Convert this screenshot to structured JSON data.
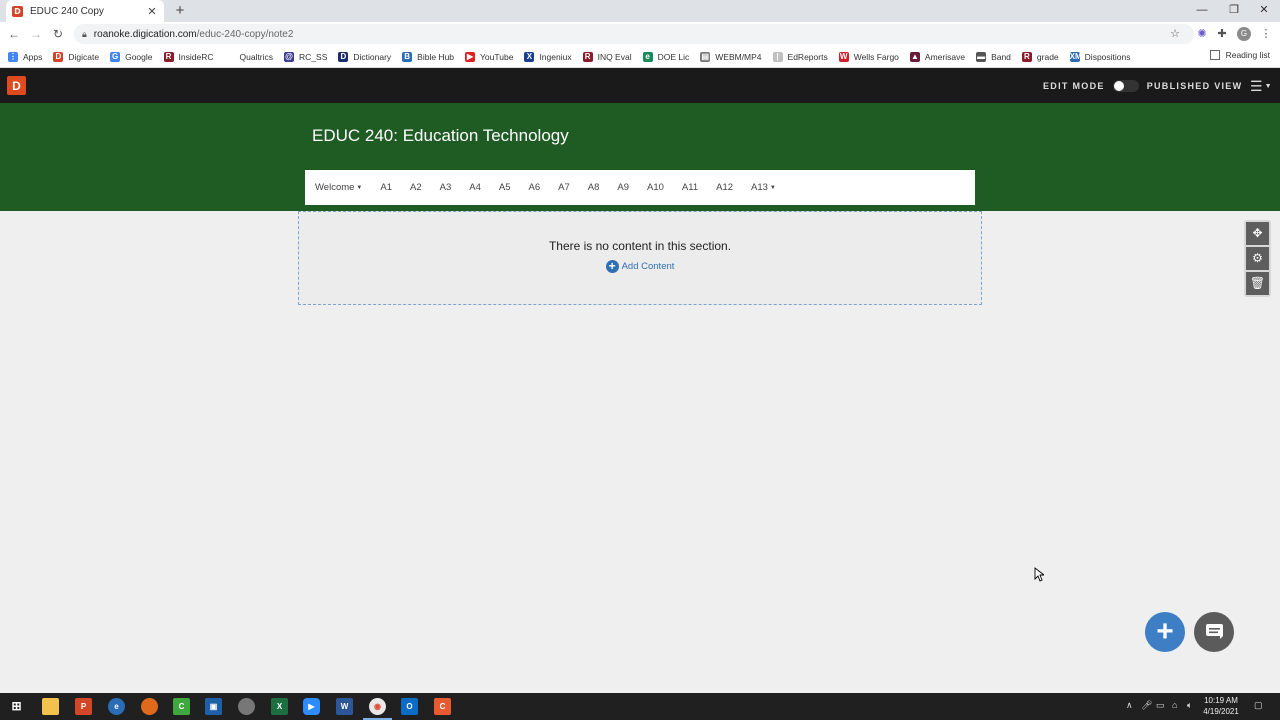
{
  "browser": {
    "tab_title": "EDUC 240 Copy",
    "url_host": "roanoke.digication.com",
    "url_path": "/educ-240-copy/note2",
    "profile_initial": "G",
    "reading_list": "Reading list"
  },
  "bookmarks": [
    {
      "label": "Apps",
      "color": "#4285f4",
      "glyph": "⋮"
    },
    {
      "label": "Digicate",
      "color": "#d6412a",
      "glyph": "D"
    },
    {
      "label": "Google",
      "color": "#4285f4",
      "glyph": "G"
    },
    {
      "label": "InsideRC",
      "color": "#8b1c2b",
      "glyph": "R"
    },
    {
      "label": "Qualtrics",
      "color": "#ffffff",
      "glyph": ""
    },
    {
      "label": "RC_SS",
      "color": "#3b3b8f",
      "glyph": "@"
    },
    {
      "label": "Dictionary",
      "color": "#1b2b6b",
      "glyph": "D"
    },
    {
      "label": "Bible Hub",
      "color": "#2a6db5",
      "glyph": "B"
    },
    {
      "label": "YouTube",
      "color": "#e02020",
      "glyph": "▶"
    },
    {
      "label": "Ingeniux",
      "color": "#1a3f8f",
      "glyph": "X"
    },
    {
      "label": "INQ Eval",
      "color": "#8b1c2b",
      "glyph": "R"
    },
    {
      "label": "DOE Lic",
      "color": "#1a8a5a",
      "glyph": "e"
    },
    {
      "label": "WEBM/MP4",
      "color": "#7a7a7a",
      "glyph": "▤"
    },
    {
      "label": "EdReports",
      "color": "#c0c0c0",
      "glyph": "|"
    },
    {
      "label": "Wells Fargo",
      "color": "#d01f28",
      "glyph": "W"
    },
    {
      "label": "Amerisave",
      "color": "#6a1b3a",
      "glyph": "▲"
    },
    {
      "label": "Band",
      "color": "#555555",
      "glyph": "▬"
    },
    {
      "label": "grade",
      "color": "#8b1c2b",
      "glyph": "R"
    },
    {
      "label": "Dispositions",
      "color": "#2a6db5",
      "glyph": "XM"
    }
  ],
  "app": {
    "logo": "D",
    "edit_mode": "EDIT MODE",
    "published_view": "PUBLISHED VIEW",
    "menu_icon": "hamburger-icon"
  },
  "site": {
    "title": "EDUC 240: Education Technology",
    "nav": [
      "Welcome",
      "A1",
      "A2",
      "A3",
      "A4",
      "A5",
      "A6",
      "A7",
      "A8",
      "A9",
      "A10",
      "A11",
      "A12",
      "A13"
    ],
    "nav_dropdowns": [
      "Welcome",
      "A13"
    ]
  },
  "section": {
    "empty_message": "There is no content in this section.",
    "add_content": "Add Content"
  },
  "taskbar": {
    "time": "10:19 AM",
    "date": "4/19/2021"
  },
  "colors": {
    "banner": "#1f5c24",
    "accent": "#3d7ec4",
    "logo": "#e04a1f"
  }
}
